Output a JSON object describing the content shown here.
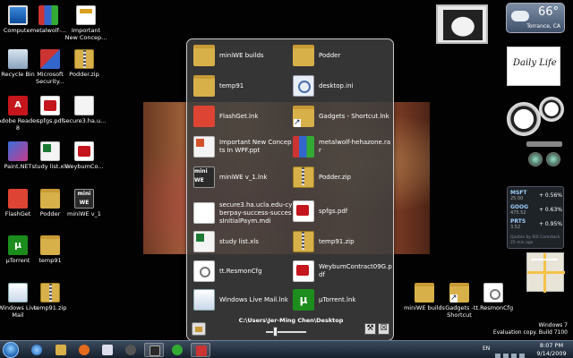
{
  "desktop_icons": [
    {
      "label": "Computer",
      "icon": "computer-icon"
    },
    {
      "label": "metalwolf-...",
      "icon": "rar-archive-icon"
    },
    {
      "label": "Important New Concep...",
      "icon": "powerpoint-icon"
    },
    {
      "label": "Recycle Bin",
      "icon": "recycle-bin-icon"
    },
    {
      "label": "Microsoft Security...",
      "icon": "security-shield-icon"
    },
    {
      "label": "Podder.zip",
      "icon": "zip-folder-icon"
    },
    {
      "label": "Adobe Reader 8",
      "icon": "adobe-reader-icon"
    },
    {
      "label": "spfgs.pdf",
      "icon": "pdf-icon"
    },
    {
      "label": "secure3.ha.u...",
      "icon": "document-icon"
    },
    {
      "label": "Paint.NET",
      "icon": "paint-icon"
    },
    {
      "label": "study list.xls",
      "icon": "excel-icon"
    },
    {
      "label": "WeybumCo...",
      "icon": "pdf-icon"
    },
    {
      "label": "FlashGet",
      "icon": "flashget-icon"
    },
    {
      "label": "Podder",
      "icon": "folder-icon"
    },
    {
      "label": "miniWE v_1",
      "icon": "miniwe-icon"
    },
    {
      "label": "µTorrent",
      "icon": "utorrent-icon"
    },
    {
      "label": "temp91",
      "icon": "folder-icon"
    },
    {
      "label": "Windows Live Mail",
      "icon": "mail-icon"
    },
    {
      "label": "temp91.zip",
      "icon": "zip-folder-icon"
    },
    {
      "label": "miniWE builds",
      "icon": "folder-icon"
    },
    {
      "label": "Gadgets - Shortcut",
      "icon": "shortcut-folder-icon"
    },
    {
      "label": "tt.ResmonCfg",
      "icon": "config-file-icon"
    }
  ],
  "stack": {
    "items": [
      {
        "name": "miniWE builds",
        "icon": "folder-icon"
      },
      {
        "name": "Podder",
        "icon": "folder-icon"
      },
      {
        "name": "temp91",
        "icon": "folder-icon"
      },
      {
        "name": "desktop.ini",
        "icon": "settings-file-icon"
      },
      {
        "name": "FlashGet.lnk",
        "icon": "flashget-icon"
      },
      {
        "name": "Gadgets - Shortcut.lnk",
        "icon": "shortcut-folder-icon"
      },
      {
        "name": "Important New Concepts In WPF.ppt",
        "icon": "powerpoint-icon"
      },
      {
        "name": "metalwolf-hehazone.rar",
        "icon": "rar-archive-icon"
      },
      {
        "name": "miniWE v_1.lnk",
        "icon": "miniwe-icon"
      },
      {
        "name": "Podder.zip",
        "icon": "zip-folder-icon"
      },
      {
        "name": "secure3.ha.ucla.edu-cyberpay-success-successInitialPaym.mdi",
        "icon": "document-icon"
      },
      {
        "name": "spfgs.pdf",
        "icon": "pdf-icon"
      },
      {
        "name": "study list.xls",
        "icon": "excel-icon"
      },
      {
        "name": "temp91.zip",
        "icon": "zip-folder-icon"
      },
      {
        "name": "tt.ResmonCfg",
        "icon": "config-file-icon"
      },
      {
        "name": "WeybumContract09G.pdf",
        "icon": "pdf-icon"
      },
      {
        "name": "Windows Live Mail.lnk",
        "icon": "mail-icon"
      },
      {
        "name": "µTorrent.lnk",
        "icon": "utorrent-icon"
      }
    ],
    "path": "C:\\Users\\Jer-Ming Chen\\Desktop",
    "tools_glyph": "⚒",
    "close_glyph": "☒"
  },
  "gadgets": {
    "weather": {
      "temp": "66°",
      "location": "Torrance, CA"
    },
    "daily_life": "Daily Life",
    "stocks": [
      {
        "symbol": "MSFT",
        "price": "25.00",
        "change": "+ 0.56%"
      },
      {
        "symbol": "GOOG",
        "price": "475.52",
        "change": "+ 0.63%"
      },
      {
        "symbol": "PRTS",
        "price": "3.52",
        "change": "+ 0.95%"
      }
    ],
    "stocks_note": "Quotes by SIX Comstock 25 min ago"
  },
  "taskbar": {
    "language": "EN",
    "time": "8:07 PM",
    "date": "9/14/2009"
  },
  "watermark": {
    "line1": "Windows 7",
    "line2": "Evaluation copy. Build 7100"
  }
}
